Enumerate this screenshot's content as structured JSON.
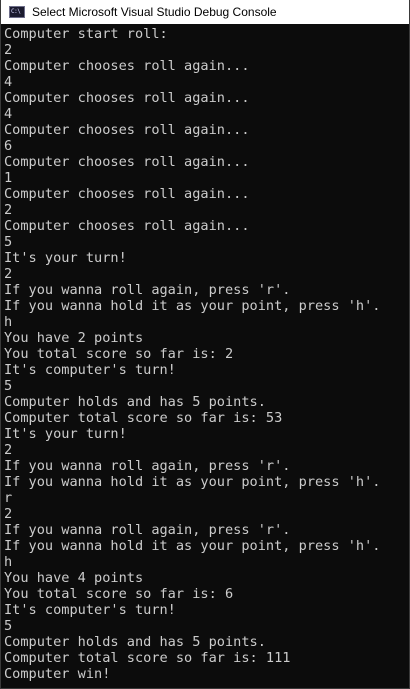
{
  "window": {
    "title": "Select Microsoft Visual Studio Debug Console",
    "icon": "console-app-icon",
    "icon_text": "C:\\"
  },
  "console": {
    "lines": [
      "Computer start roll:",
      "2",
      "Computer chooses roll again...",
      "4",
      "Computer chooses roll again...",
      "4",
      "Computer chooses roll again...",
      "6",
      "Computer chooses roll again...",
      "1",
      "Computer chooses roll again...",
      "2",
      "Computer chooses roll again...",
      "5",
      "It's your turn!",
      "2",
      "If you wanna roll again, press 'r'.",
      "If you wanna hold it as your point, press 'h'.",
      "h",
      "You have 2 points",
      "You total score so far is: 2",
      "It's computer's turn!",
      "5",
      "Computer holds and has 5 points.",
      "Computer total score so far is: 53",
      "It's your turn!",
      "2",
      "If you wanna roll again, press 'r'.",
      "If you wanna hold it as your point, press 'h'.",
      "r",
      "2",
      "If you wanna roll again, press 'r'.",
      "If you wanna hold it as your point, press 'h'.",
      "h",
      "You have 4 points",
      "You total score so far is: 6",
      "It's computer's turn!",
      "5",
      "Computer holds and has 5 points.",
      "Computer total score so far is: 111",
      "Computer win!"
    ]
  },
  "colors": {
    "console_background": "#0c0c0c",
    "console_text": "#cccccc",
    "titlebar_background": "#ffffff",
    "title_text": "#000000"
  }
}
